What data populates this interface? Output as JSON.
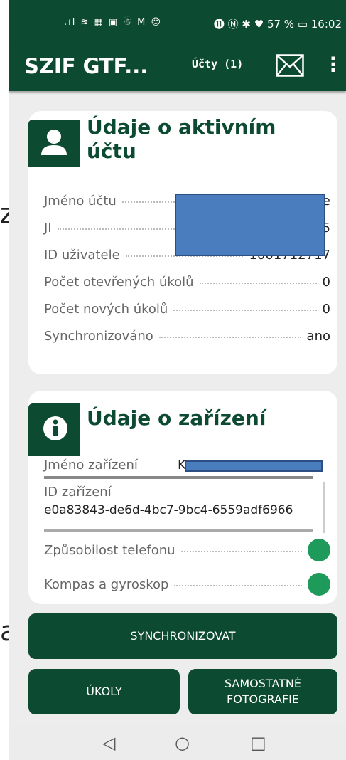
{
  "status_bar": {
    "left_icons": ".ıl ≋ ▦ ▣ ☃ M ☺",
    "right_text": "⓫ Ⓝ ✱ ♥ 57 % ▭ 16:02"
  },
  "app_bar": {
    "title": "SZIF GTF...",
    "accounts_label": "Účty (1)"
  },
  "active_account": {
    "title_line1": "Údaje o aktivním",
    "title_line2": "účtu",
    "rows": [
      {
        "label": "Jméno účtu",
        "value": "e"
      },
      {
        "label": "JI",
        "value": "5"
      },
      {
        "label": "ID uživatele",
        "value": "1001712717"
      },
      {
        "label": "Počet otevřených úkolů",
        "value": "0"
      },
      {
        "label": "Počet nových úkolů",
        "value": "0"
      },
      {
        "label": "Synchronizováno",
        "value": "ano"
      }
    ]
  },
  "device": {
    "title": "Údaje o zařízení",
    "name_label": "Jméno zařízení",
    "name_value": "K",
    "id_label": "ID zařízení",
    "id_value": "e0a83843-de6d-4bc7-9bc4-6559adf6966",
    "rows": [
      {
        "label": "Způsobilost telefonu",
        "status": "ok"
      },
      {
        "label": "Kompas a gyroskop",
        "status": "ok"
      }
    ]
  },
  "buttons": {
    "sync": "SYNCHRONIZOVAT",
    "tasks": "ÚKOLY",
    "photos_line1": "SAMOSTATNÉ",
    "photos_line2": "FOTOGRAFIE"
  },
  "background_text": {
    "left_top": "za",
    "left_bottom": "a"
  },
  "colors": {
    "primary": "#0d4a32",
    "status_ok": "#1e9a5a",
    "redaction": "#4a7dbd"
  }
}
